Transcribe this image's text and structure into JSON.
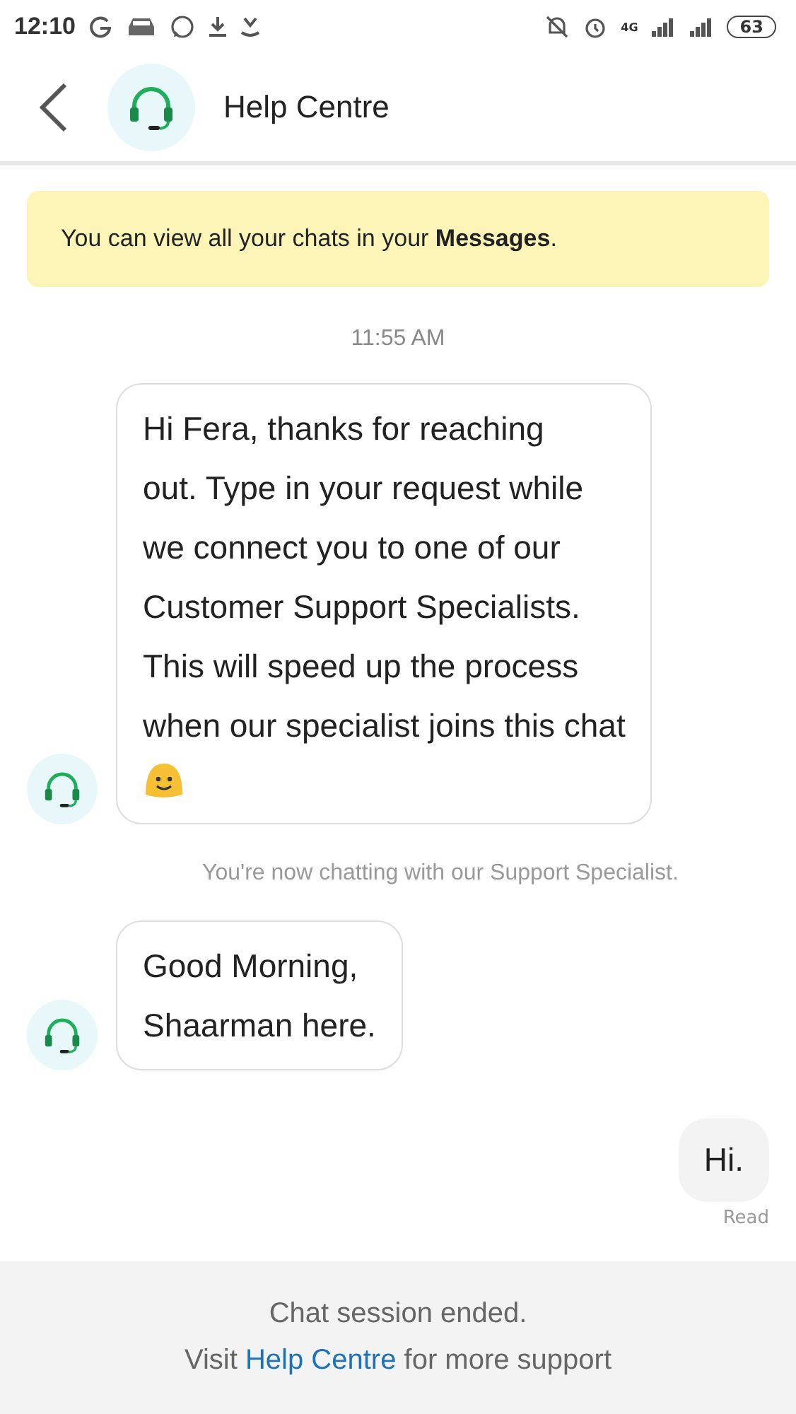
{
  "status_bar": {
    "time": "12:10",
    "battery": "63",
    "network": "4G"
  },
  "header": {
    "title": "Help Centre"
  },
  "banner": {
    "text": "You can view all your chats in your **Messages**."
  },
  "chat": [
    {
      "kind": "time",
      "text": "11:55 AM"
    },
    {
      "kind": "agent",
      "lines": [
        "Hi Fera, thanks for reaching",
        "out. Type in your request while",
        "we connect you to one of our",
        "Customer Support Specialists.",
        "This will speed up the process",
        "when our specialist joins this chat"
      ],
      "emoji": true
    },
    {
      "kind": "notice",
      "text": "You're now chatting with our Support Specialist."
    },
    {
      "kind": "agent",
      "lines": [
        "Good Morning,",
        "Shaarman here."
      ],
      "emoji": false
    },
    {
      "kind": "user",
      "text": "Hi.",
      "status": "Read"
    }
  ],
  "footer": {
    "line1": "Chat session ended.",
    "prefix": "Visit",
    "link": "Help Centre",
    "suffix": "for more support"
  }
}
